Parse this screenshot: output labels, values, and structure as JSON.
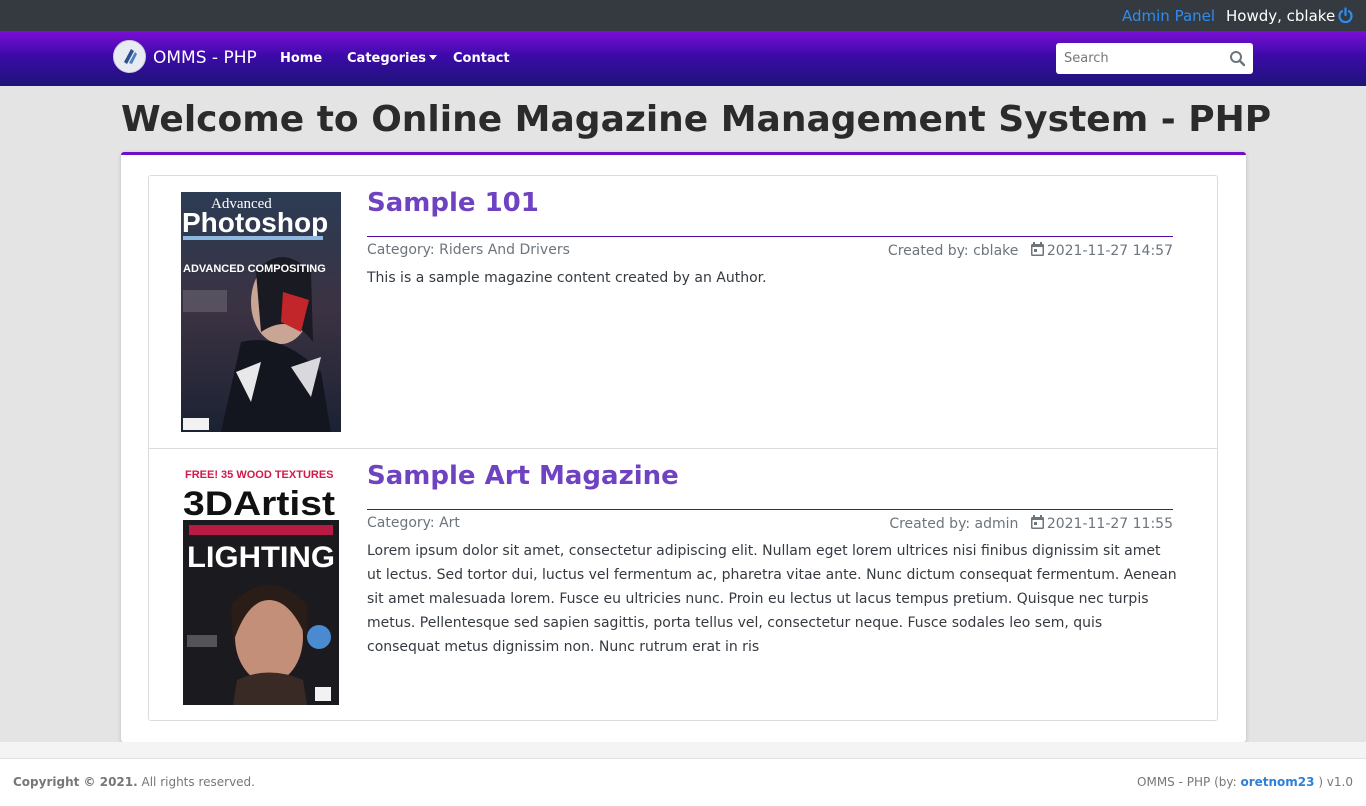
{
  "topbar": {
    "admin_link": "Admin Panel",
    "howdy": "Howdy, cblake",
    "power_icon": "power-icon",
    "link_color": "#2f8cf0"
  },
  "navbar": {
    "brand": "OMMS - PHP",
    "items": [
      {
        "label": "Home"
      },
      {
        "label": "Categories"
      },
      {
        "label": "Contact"
      }
    ],
    "search_placeholder": "Search",
    "search_icon": "search-icon",
    "gradient": [
      "#7a0fd6",
      "#3c0aa8",
      "#1d1478"
    ]
  },
  "main": {
    "title": "Welcome to Online Magazine Management System - PHP",
    "accent": "#6f0fc9",
    "items": [
      {
        "title": "Sample 101",
        "category": "Category: Riders And Drivers",
        "created_by": "Created by: cblake",
        "date": "2021-11-27 14:57",
        "description": "This is a sample magazine content created by an Author.",
        "cover": {
          "masthead_1": "Advanced",
          "masthead_2": "Photoshop",
          "tagline": "ADVANCED COMPOSITING"
        }
      },
      {
        "title": "Sample Art Magazine",
        "category": "Category: Art",
        "created_by": "Created by: admin",
        "date": "2021-11-27 11:55",
        "description": "Lorem ipsum dolor sit amet, consectetur adipiscing elit. Nullam eget lorem ultrices nisi finibus dignissim sit amet ut lectus. Sed tortor dui, luctus vel fermentum ac, pharetra vitae ante. Nunc dictum consequat fermentum. Aenean sit amet malesuada lorem. Fusce eu ultricies nunc. Proin eu lectus ut lacus tempus pretium. Quisque nec turpis metus. Pellentesque sed sapien sagittis, porta tellus vel, consectetur neque. Fusce sodales leo sem, quis consequat metus dignissim non. Nunc rutrum erat in ris",
        "cover": {
          "banner": "FREE! 35 WOOD TEXTURES",
          "masthead": "3DArtist",
          "tagline": "LIGHTING"
        }
      }
    ]
  },
  "footer": {
    "copyright_bold": "Copyright © 2021.",
    "copyright_rest": " All rights reserved.",
    "credit_prefix": "OMMS - PHP (by: ",
    "credit_link": "oretnom23",
    "credit_suffix": " ) v1.0"
  }
}
